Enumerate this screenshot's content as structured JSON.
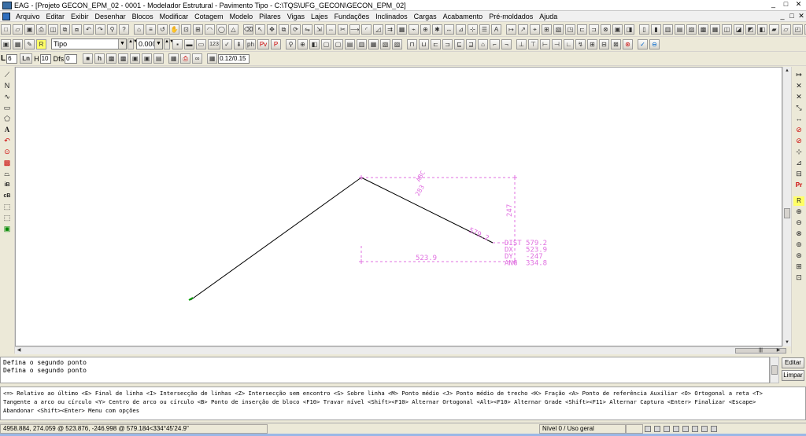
{
  "window": {
    "title": "EAG - [Projeto GECON_EPM_02 - 0001 - Modelador Estrutural - Pavimento Tipo - C:\\TQS\\UFG_GECON\\GECON_EPM_02]",
    "minimize": "_",
    "maximize": "□",
    "close": "✕"
  },
  "menu": {
    "items": [
      "Arquivo",
      "Editar",
      "Exibir",
      "Desenhar",
      "Blocos",
      "Modificar",
      "Cotagem",
      "Modelo",
      "Pilares",
      "Vigas",
      "Lajes",
      "Fundações",
      "Inclinados",
      "Cargas",
      "Acabamento",
      "Pré-moldados",
      "Ajuda"
    ]
  },
  "toolbar2": {
    "floor_combo": "Tipo",
    "elevation_combo": "0.000",
    "text_badge": "123",
    "pv_label": "Pv",
    "p_label": "P"
  },
  "toolbar3": {
    "L_label": "L",
    "L_value": "6",
    "Ln_label": "Ln",
    "H_label": "H",
    "H_value": "10",
    "Dfs_label": "Dfs",
    "Dfs_value": "0",
    "h_label": "h",
    "ratio_value": "0.12/0.15"
  },
  "drawing": {
    "dim_top_label": "ABC",
    "dim_left_label": "283",
    "dim_vertical": "247",
    "dim_horizontal": "523.9",
    "dim_diagonal": "579.2",
    "readout": [
      {
        "label": "DIST",
        "value": "579.2"
      },
      {
        "label": "DX",
        "value": "523.9"
      },
      {
        "label": "DY",
        "value": "-247"
      },
      {
        "label": "ANG",
        "value": "334.8"
      }
    ]
  },
  "command": {
    "history": [
      "Defina o segundo ponto",
      "Defina o segundo ponto"
    ],
    "edit_button": "Editar",
    "clear_button": "Limpar"
  },
  "options": {
    "lines": [
      "<=> Relativo ao último <E> Final de linha <I> Intersecção de linhas <Z> Intersecção sem encontro <S> Sobre linha <M> Ponto médio <J> Ponto médio de trecho <K> Fração <A> Ponto de referência Auxiliar <O> Ortogonal a reta <T>",
      "Tangente a arco ou círculo <Y> Centro de arco ou círculo <B> Ponto de inserção de bloco <F10> Travar nível <Shift><F10> Alternar Ortogonal <Alt><F10> Alternar Grade <Shift><F11> Alternar Captura <Enter> Finalizar <Escape>",
      "Abandonar <Shift><Enter> Menu com opções"
    ]
  },
  "status": {
    "coords": "4958.884,  274.059  @  523.876,  -246.998  @   579.184<334°45'24.9\"",
    "level": "Nível 0 / Uso geral"
  },
  "colors": {
    "dimension": "#e070e0",
    "polyline": "#000000",
    "endpoint": "#00a000"
  }
}
